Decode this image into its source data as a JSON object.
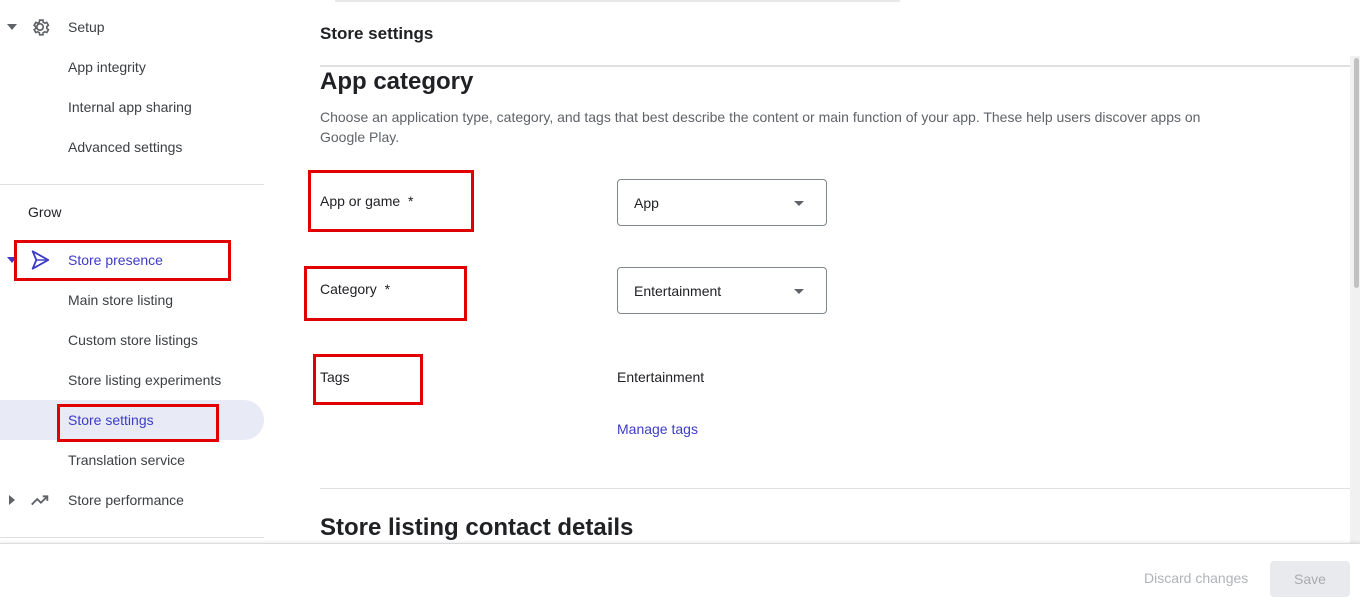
{
  "sidebar": {
    "setup": {
      "label": "Setup",
      "icon": "gear-icon"
    },
    "setup_items": [
      "App integrity",
      "Internal app sharing",
      "Advanced settings"
    ],
    "grow_heading": "Grow",
    "store_presence": {
      "label": "Store presence",
      "icon": "play-icon"
    },
    "store_presence_items": [
      "Main store listing",
      "Custom store listings",
      "Store listing experiments",
      "Store settings",
      "Translation service"
    ],
    "store_performance": {
      "label": "Store performance",
      "icon": "trending-up-icon"
    },
    "active_item": "Store settings"
  },
  "main": {
    "page_title": "Store settings",
    "app_category": {
      "title": "App category",
      "description": "Choose an application type, category, and tags that best describe the content or main function of your app. These help users discover apps on Google Play.",
      "app_or_game": {
        "label": "App or game",
        "required_mark": "*",
        "value": "App"
      },
      "category": {
        "label": "Category",
        "required_mark": "*",
        "value": "Entertainment"
      },
      "tags": {
        "label": "Tags",
        "value": "Entertainment",
        "manage_link": "Manage tags"
      }
    },
    "contact_section_title": "Store listing contact details"
  },
  "footer": {
    "discard_label": "Discard changes",
    "save_label": "Save"
  },
  "colors": {
    "accent": "#3c3cc6",
    "highlight_box": "#e00000",
    "active_bg": "#e8eaf6"
  }
}
